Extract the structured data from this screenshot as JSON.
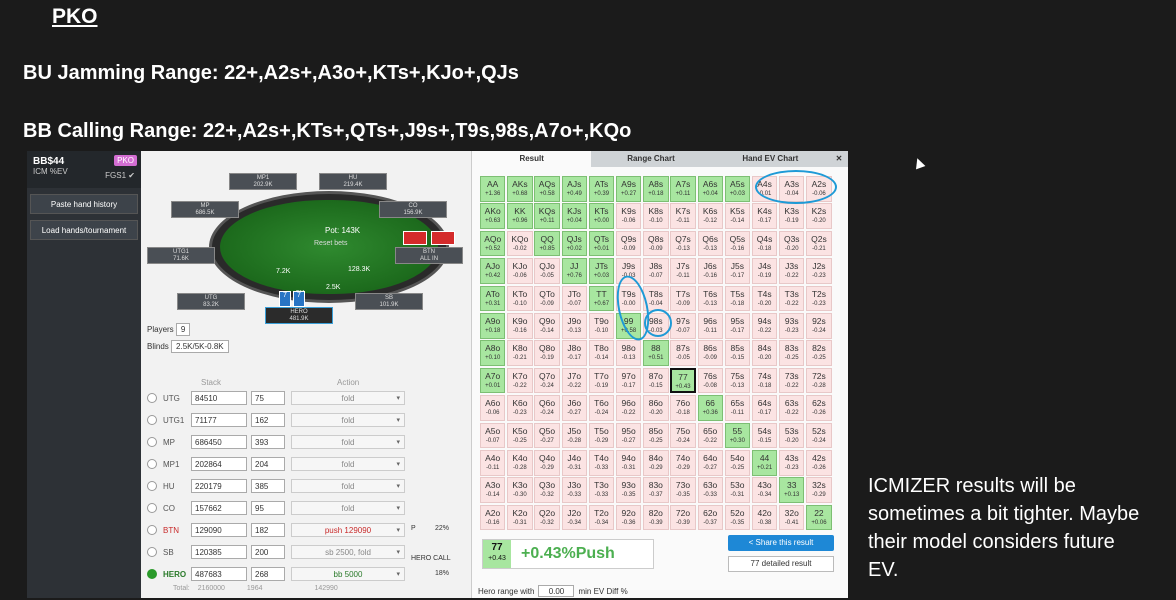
{
  "slide": {
    "title": "PKO",
    "bu_range": "BU Jamming Range: 22+,A2s+,A3o+,KTs+,KJo+,QJs",
    "bb_range": "BB Calling Range: 22+,A2s+,KTs+,QTs+,J9s+,T9s,98s,A7o+,KQo",
    "note": "ICMIZER results will be sometimes a bit tighter. Maybe their model considers future EV."
  },
  "sidebar": {
    "player": "BB$44",
    "mode": "ICM %EV",
    "badge": "PKO",
    "fgs": "FGS1 ✔",
    "paste_label": "Paste hand history",
    "load_label": "Load hands/tournament"
  },
  "table": {
    "pot": "Pot: 143K",
    "reset": "Reset bets",
    "chips": {
      "left": "7.2K",
      "mid": "128.3K",
      "right": "2.5K",
      "bottom": "5K"
    },
    "seats": {
      "mp1": "MP1\n202.9K",
      "hu": "HU\n219.4K",
      "mp": "MP\n686.5K",
      "co": "CO\n156.9K",
      "utg1": "UTG1\n71.6K",
      "btn": "BTN\nALL IN",
      "utg": "UTG\n83.2K",
      "sb": "SB\n101.9K",
      "hero": "HERO\n481.9K"
    }
  },
  "settings": {
    "players_label": "Players",
    "players_value": "9",
    "blinds_label": "Blinds",
    "blinds_value": "2.5K/5K-0.8K",
    "stack_head": "Stack",
    "action_head": "Action"
  },
  "players": [
    {
      "pos": "UTG",
      "stack": "84510",
      "bb": "75",
      "action": "fold"
    },
    {
      "pos": "UTG1",
      "stack": "71177",
      "bb": "162",
      "action": "fold"
    },
    {
      "pos": "MP",
      "stack": "686450",
      "bb": "393",
      "action": "fold"
    },
    {
      "pos": "MP1",
      "stack": "202864",
      "bb": "204",
      "action": "fold"
    },
    {
      "pos": "HU",
      "stack": "220179",
      "bb": "385",
      "action": "fold"
    },
    {
      "pos": "CO",
      "stack": "157662",
      "bb": "95",
      "action": "fold"
    },
    {
      "pos": "BTN",
      "stack": "129090",
      "bb": "182",
      "action": "push 129090"
    },
    {
      "pos": "SB",
      "stack": "120385",
      "bb": "200",
      "action": "sb 2500, fold"
    },
    {
      "pos": "HERO",
      "stack": "487683",
      "bb": "268",
      "action": "bb 5000"
    }
  ],
  "btn_pct": "22%",
  "btn_p_label": "P",
  "hero_call_label": "HERO CALL",
  "hero_call_pct": "18%",
  "totals": {
    "label": "Total:",
    "stack": "2160000",
    "bb": "1964",
    "action": "142990"
  },
  "tabs": [
    "Result",
    "Range Chart",
    "Hand EV Chart"
  ],
  "close": "✕",
  "grid": [
    [
      [
        "AA",
        "+1.36",
        1
      ],
      [
        "AKs",
        "+0.68",
        1
      ],
      [
        "AQs",
        "+0.58",
        1
      ],
      [
        "AJs",
        "+0.49",
        1
      ],
      [
        "ATs",
        "+0.39",
        1
      ],
      [
        "A9s",
        "+0.27",
        1
      ],
      [
        "A8s",
        "+0.18",
        1
      ],
      [
        "A7s",
        "+0.11",
        1
      ],
      [
        "A6s",
        "+0.04",
        1
      ],
      [
        "A5s",
        "+0.03",
        1
      ],
      [
        "A4s",
        "-0.01",
        0
      ],
      [
        "A3s",
        "-0.04",
        0
      ],
      [
        "A2s",
        "-0.06",
        0
      ]
    ],
    [
      [
        "AKo",
        "+0.63",
        1
      ],
      [
        "KK",
        "+0.96",
        1
      ],
      [
        "KQs",
        "+0.11",
        1
      ],
      [
        "KJs",
        "+0.04",
        1
      ],
      [
        "KTs",
        "+0.00",
        1
      ],
      [
        "K9s",
        "-0.06",
        0
      ],
      [
        "K8s",
        "-0.10",
        0
      ],
      [
        "K7s",
        "-0.11",
        0
      ],
      [
        "K6s",
        "-0.12",
        0
      ],
      [
        "K5s",
        "-0.14",
        0
      ],
      [
        "K4s",
        "-0.17",
        0
      ],
      [
        "K3s",
        "-0.19",
        0
      ],
      [
        "K2s",
        "-0.20",
        0
      ]
    ],
    [
      [
        "AQo",
        "+0.52",
        1
      ],
      [
        "KQo",
        "-0.02",
        0
      ],
      [
        "QQ",
        "+0.85",
        1
      ],
      [
        "QJs",
        "+0.02",
        1
      ],
      [
        "QTs",
        "+0.01",
        1
      ],
      [
        "Q9s",
        "-0.09",
        0
      ],
      [
        "Q8s",
        "-0.09",
        0
      ],
      [
        "Q7s",
        "-0.13",
        0
      ],
      [
        "Q6s",
        "-0.13",
        0
      ],
      [
        "Q5s",
        "-0.16",
        0
      ],
      [
        "Q4s",
        "-0.18",
        0
      ],
      [
        "Q3s",
        "-0.20",
        0
      ],
      [
        "Q2s",
        "-0.21",
        0
      ]
    ],
    [
      [
        "AJo",
        "+0.42",
        1
      ],
      [
        "KJo",
        "-0.06",
        0
      ],
      [
        "QJo",
        "-0.05",
        0
      ],
      [
        "JJ",
        "+0.76",
        1
      ],
      [
        "JTs",
        "+0.03",
        1
      ],
      [
        "J9s",
        "-0.03",
        0
      ],
      [
        "J8s",
        "-0.07",
        0
      ],
      [
        "J7s",
        "-0.11",
        0
      ],
      [
        "J6s",
        "-0.16",
        0
      ],
      [
        "J5s",
        "-0.17",
        0
      ],
      [
        "J4s",
        "-0.19",
        0
      ],
      [
        "J3s",
        "-0.22",
        0
      ],
      [
        "J2s",
        "-0.23",
        0
      ]
    ],
    [
      [
        "ATo",
        "+0.31",
        1
      ],
      [
        "KTo",
        "-0.10",
        0
      ],
      [
        "QTo",
        "-0.09",
        0
      ],
      [
        "JTo",
        "-0.07",
        0
      ],
      [
        "TT",
        "+0.67",
        1
      ],
      [
        "T9s",
        "-0.00",
        0
      ],
      [
        "T8s",
        "-0.04",
        0
      ],
      [
        "T7s",
        "-0.09",
        0
      ],
      [
        "T6s",
        "-0.13",
        0
      ],
      [
        "T5s",
        "-0.18",
        0
      ],
      [
        "T4s",
        "-0.20",
        0
      ],
      [
        "T3s",
        "-0.22",
        0
      ],
      [
        "T2s",
        "-0.23",
        0
      ]
    ],
    [
      [
        "A9o",
        "+0.18",
        1
      ],
      [
        "K9o",
        "-0.16",
        0
      ],
      [
        "Q9o",
        "-0.14",
        0
      ],
      [
        "J9o",
        "-0.13",
        0
      ],
      [
        "T9o",
        "-0.10",
        0
      ],
      [
        "99",
        "+0.58",
        1
      ],
      [
        "98s",
        "-0.03",
        0
      ],
      [
        "97s",
        "-0.07",
        0
      ],
      [
        "96s",
        "-0.11",
        0
      ],
      [
        "95s",
        "-0.17",
        0
      ],
      [
        "94s",
        "-0.22",
        0
      ],
      [
        "93s",
        "-0.23",
        0
      ],
      [
        "92s",
        "-0.24",
        0
      ]
    ],
    [
      [
        "A8o",
        "+0.10",
        1
      ],
      [
        "K8o",
        "-0.21",
        0
      ],
      [
        "Q8o",
        "-0.19",
        0
      ],
      [
        "J8o",
        "-0.17",
        0
      ],
      [
        "T8o",
        "-0.14",
        0
      ],
      [
        "98o",
        "-0.13",
        0
      ],
      [
        "88",
        "+0.51",
        1
      ],
      [
        "87s",
        "-0.05",
        0
      ],
      [
        "86s",
        "-0.09",
        0
      ],
      [
        "85s",
        "-0.15",
        0
      ],
      [
        "84s",
        "-0.20",
        0
      ],
      [
        "83s",
        "-0.25",
        0
      ],
      [
        "82s",
        "-0.25",
        0
      ]
    ],
    [
      [
        "A7o",
        "+0.01",
        1
      ],
      [
        "K7o",
        "-0.22",
        0
      ],
      [
        "Q7o",
        "-0.24",
        0
      ],
      [
        "J7o",
        "-0.22",
        0
      ],
      [
        "T7o",
        "-0.19",
        0
      ],
      [
        "97o",
        "-0.17",
        0
      ],
      [
        "87o",
        "-0.15",
        0
      ],
      [
        "77",
        "+0.43",
        1
      ],
      [
        "76s",
        "-0.08",
        0
      ],
      [
        "75s",
        "-0.13",
        0
      ],
      [
        "74s",
        "-0.18",
        0
      ],
      [
        "73s",
        "-0.22",
        0
      ],
      [
        "72s",
        "-0.28",
        0
      ]
    ],
    [
      [
        "A6o",
        "-0.06",
        0
      ],
      [
        "K6o",
        "-0.23",
        0
      ],
      [
        "Q6o",
        "-0.24",
        0
      ],
      [
        "J6o",
        "-0.27",
        0
      ],
      [
        "T6o",
        "-0.24",
        0
      ],
      [
        "96o",
        "-0.22",
        0
      ],
      [
        "86o",
        "-0.20",
        0
      ],
      [
        "76o",
        "-0.18",
        0
      ],
      [
        "66",
        "+0.36",
        1
      ],
      [
        "65s",
        "-0.11",
        0
      ],
      [
        "64s",
        "-0.17",
        0
      ],
      [
        "63s",
        "-0.22",
        0
      ],
      [
        "62s",
        "-0.26",
        0
      ]
    ],
    [
      [
        "A5o",
        "-0.07",
        0
      ],
      [
        "K5o",
        "-0.25",
        0
      ],
      [
        "Q5o",
        "-0.27",
        0
      ],
      [
        "J5o",
        "-0.28",
        0
      ],
      [
        "T5o",
        "-0.29",
        0
      ],
      [
        "95o",
        "-0.27",
        0
      ],
      [
        "85o",
        "-0.25",
        0
      ],
      [
        "75o",
        "-0.24",
        0
      ],
      [
        "65o",
        "-0.22",
        0
      ],
      [
        "55",
        "+0.30",
        1
      ],
      [
        "54s",
        "-0.15",
        0
      ],
      [
        "53s",
        "-0.20",
        0
      ],
      [
        "52s",
        "-0.24",
        0
      ]
    ],
    [
      [
        "A4o",
        "-0.11",
        0
      ],
      [
        "K4o",
        "-0.28",
        0
      ],
      [
        "Q4o",
        "-0.29",
        0
      ],
      [
        "J4o",
        "-0.31",
        0
      ],
      [
        "T4o",
        "-0.33",
        0
      ],
      [
        "94o",
        "-0.31",
        0
      ],
      [
        "84o",
        "-0.29",
        0
      ],
      [
        "74o",
        "-0.29",
        0
      ],
      [
        "64o",
        "-0.27",
        0
      ],
      [
        "54o",
        "-0.25",
        0
      ],
      [
        "44",
        "+0.21",
        1
      ],
      [
        "43s",
        "-0.23",
        0
      ],
      [
        "42s",
        "-0.26",
        0
      ]
    ],
    [
      [
        "A3o",
        "-0.14",
        0
      ],
      [
        "K3o",
        "-0.30",
        0
      ],
      [
        "Q3o",
        "-0.32",
        0
      ],
      [
        "J3o",
        "-0.33",
        0
      ],
      [
        "T3o",
        "-0.33",
        0
      ],
      [
        "93o",
        "-0.35",
        0
      ],
      [
        "83o",
        "-0.37",
        0
      ],
      [
        "73o",
        "-0.35",
        0
      ],
      [
        "63o",
        "-0.33",
        0
      ],
      [
        "53o",
        "-0.31",
        0
      ],
      [
        "43o",
        "-0.34",
        0
      ],
      [
        "33",
        "+0.13",
        1
      ],
      [
        "32s",
        "-0.29",
        0
      ]
    ],
    [
      [
        "A2o",
        "-0.16",
        0
      ],
      [
        "K2o",
        "-0.31",
        0
      ],
      [
        "Q2o",
        "-0.32",
        0
      ],
      [
        "J2o",
        "-0.34",
        0
      ],
      [
        "T2o",
        "-0.34",
        0
      ],
      [
        "92o",
        "-0.36",
        0
      ],
      [
        "82o",
        "-0.39",
        0
      ],
      [
        "72o",
        "-0.39",
        0
      ],
      [
        "62o",
        "-0.37",
        0
      ],
      [
        "52o",
        "-0.35",
        0
      ],
      [
        "42o",
        "-0.38",
        0
      ],
      [
        "32o",
        "-0.41",
        0
      ],
      [
        "22",
        "+0.06",
        1
      ]
    ]
  ],
  "result": {
    "hand": "77",
    "ev": "+0.43",
    "text": "+0.43%Push",
    "share_label": "Share this result",
    "detailed_label": "77 detailed result",
    "hero_range_label": "Hero range with",
    "hero_range_value": "0.00",
    "min_ev_label": "min EV Diff %"
  },
  "colors": {
    "push": "#a8e6a0",
    "fold": "#fbe3e3",
    "accent": "#1e88d6",
    "ring": "#1e9ad6"
  }
}
